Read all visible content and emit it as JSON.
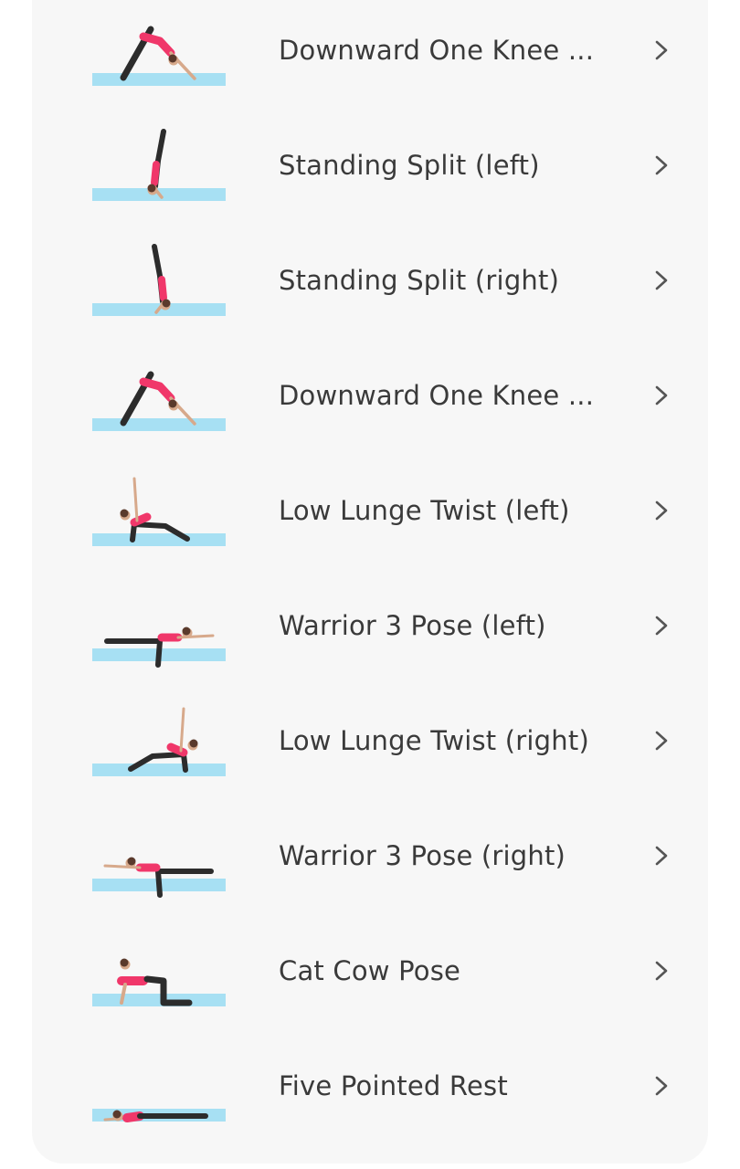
{
  "exercises": [
    {
      "name": "Downward One Knee ...",
      "icon": "downward-one-knee-pose-icon"
    },
    {
      "name": "Standing Split (left)",
      "icon": "standing-split-left-pose-icon"
    },
    {
      "name": "Standing Split (right)",
      "icon": "standing-split-right-pose-icon"
    },
    {
      "name": "Downward One Knee ...",
      "icon": "downward-one-knee-pose-icon"
    },
    {
      "name": "Low Lunge Twist (left)",
      "icon": "low-lunge-twist-left-pose-icon"
    },
    {
      "name": "Warrior 3 Pose (left)",
      "icon": "warrior-3-left-pose-icon"
    },
    {
      "name": "Low Lunge Twist (right)",
      "icon": "low-lunge-twist-right-pose-icon"
    },
    {
      "name": "Warrior 3 Pose (right)",
      "icon": "warrior-3-right-pose-icon"
    },
    {
      "name": "Cat Cow Pose",
      "icon": "cat-cow-pose-icon"
    },
    {
      "name": "Five Pointed Rest",
      "icon": "five-pointed-rest-pose-icon"
    }
  ],
  "colors": {
    "mat": "#a7e0f3",
    "top": "#f0376a",
    "pants": "#2c2c2c",
    "skin": "#d7a98b",
    "hair": "#5a3a2c",
    "text": "#3a3a3a",
    "chevron": "#555555",
    "card": "#f7f7f7"
  }
}
